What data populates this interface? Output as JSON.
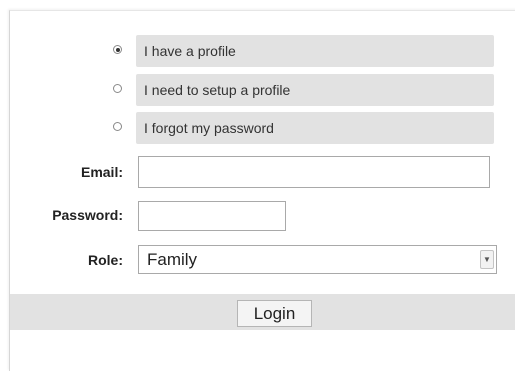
{
  "profile_options": [
    {
      "label": "I have a profile",
      "checked": true
    },
    {
      "label": "I need to setup a profile",
      "checked": false
    },
    {
      "label": "I forgot my password",
      "checked": false
    }
  ],
  "email": {
    "label": "Email:",
    "value": ""
  },
  "password": {
    "label": "Password:",
    "value": ""
  },
  "role": {
    "label": "Role:",
    "selected": "Family"
  },
  "login_button": "Login",
  "colors": {
    "option_background": "#e2e2e2",
    "footer_background": "#e2e2e2"
  }
}
